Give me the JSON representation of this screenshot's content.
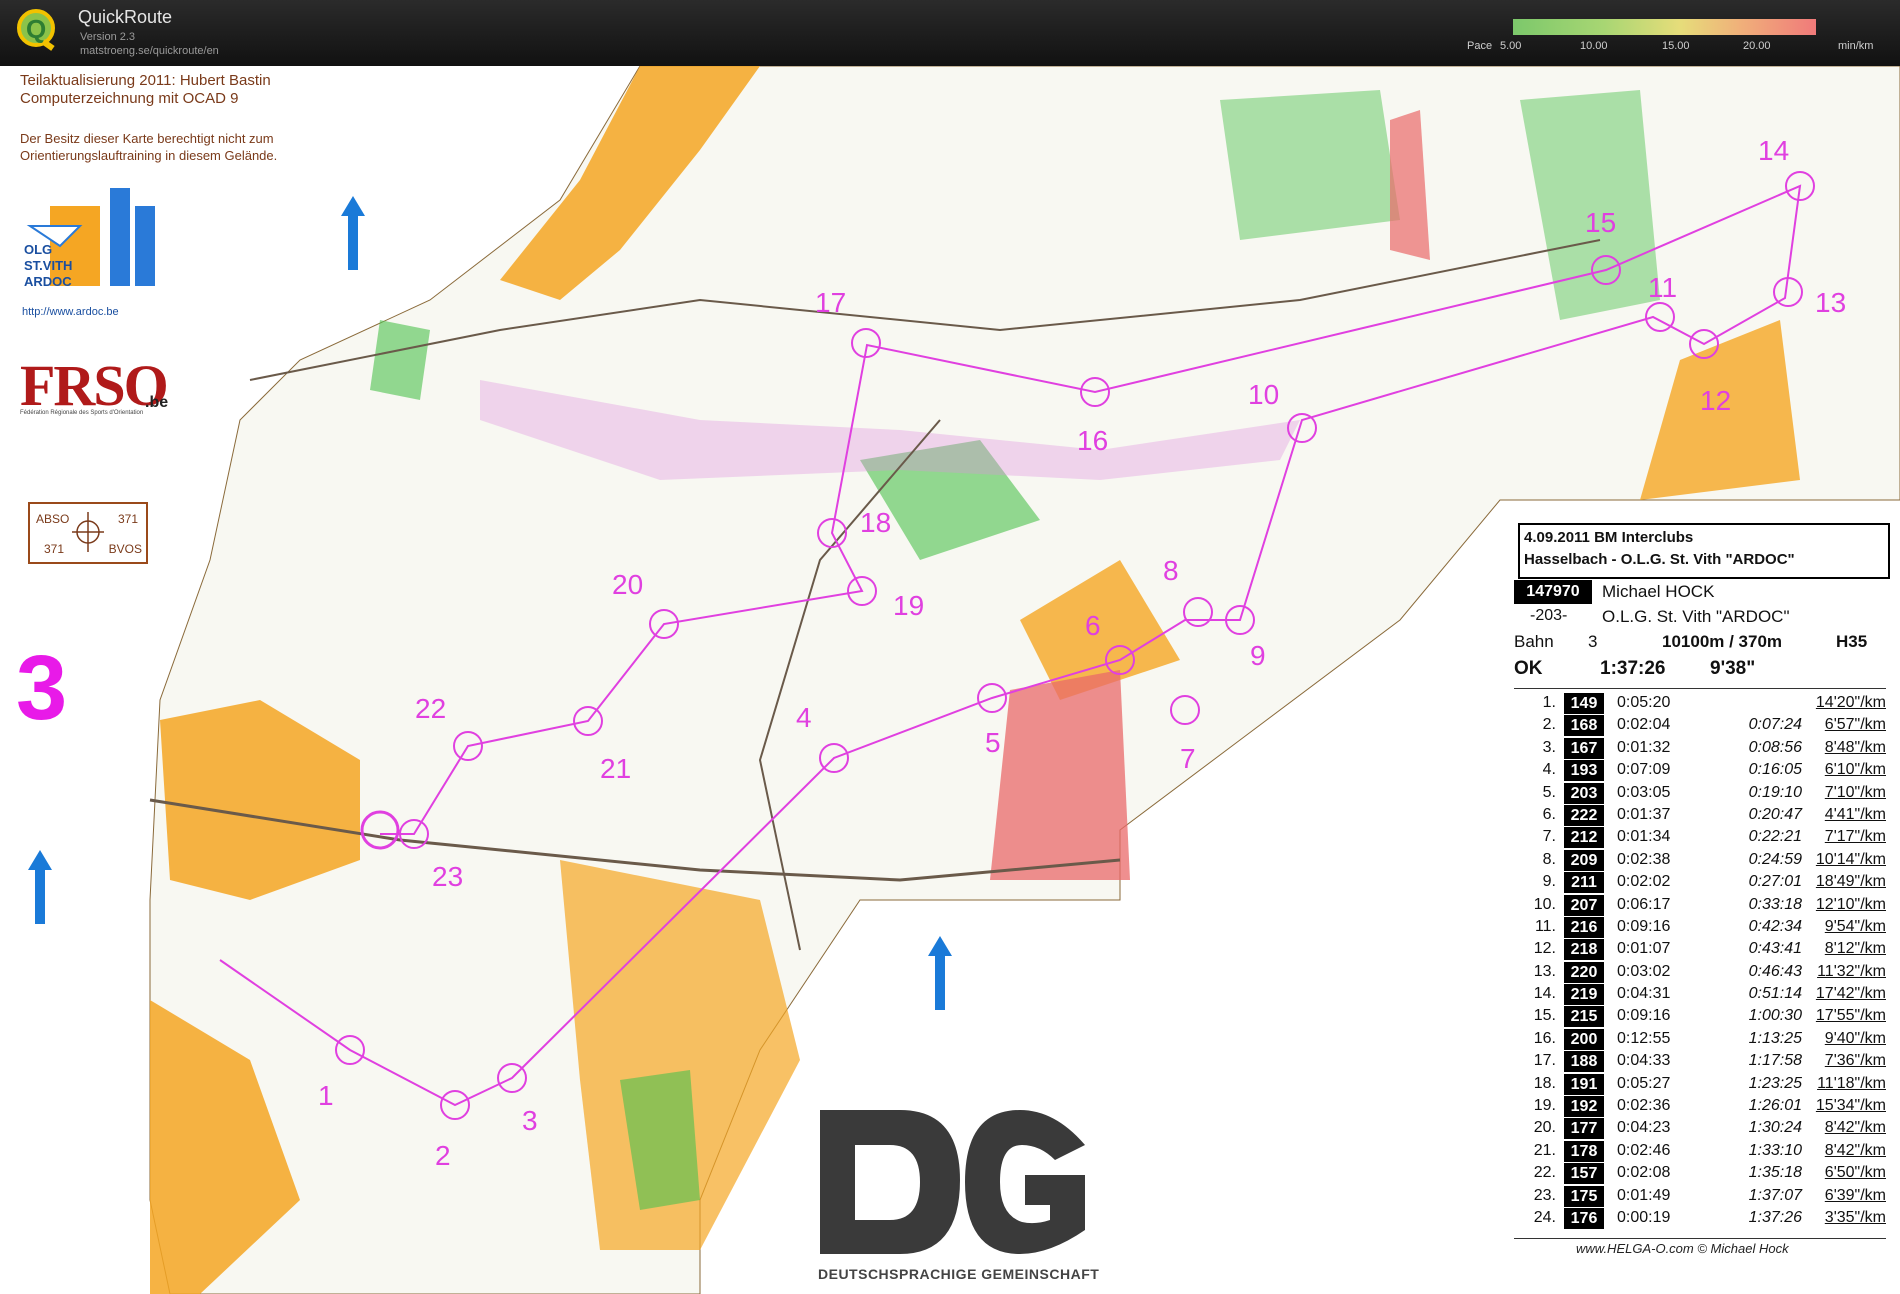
{
  "app": {
    "name": "QuickRoute",
    "version": "Version 2.3",
    "url": "matstroeng.se/quickroute/en"
  },
  "pace_scale": {
    "label": "Pace",
    "ticks": [
      "5.00",
      "10.00",
      "15.00",
      "20.00"
    ],
    "unit": "min/km"
  },
  "map": {
    "credits": [
      "Teilaktualisierung 2011: Hubert Bastin",
      "Computerzeichnung mit OCAD 9"
    ],
    "note": [
      "Der Besitz dieser Karte berechtigt nicht zum",
      "Orientierungslauftraining in diesem Gelände."
    ],
    "club_logo": {
      "lines": [
        "OLG",
        "ST.VITH",
        "ARDOC"
      ],
      "url": "http://www.ardoc.be"
    },
    "federation_logo": {
      "text": "FRSO",
      "suffix": ".be",
      "subtitle": "Fédération Régionale des Sports d'Orientation"
    },
    "compass_box": {
      "tl": "ABSO",
      "tr": "371",
      "bl": "371",
      "br": "BVOS"
    },
    "course_number": "3",
    "control_labels": [
      "1",
      "2",
      "3",
      "4",
      "5",
      "6",
      "7",
      "8",
      "9",
      "10",
      "11",
      "12",
      "13",
      "14",
      "15",
      "16",
      "17",
      "18",
      "19",
      "20",
      "21",
      "22",
      "23"
    ],
    "sponsor": {
      "logo": "DG",
      "text": "DEUTSCHSPRACHIGE GEMEINSCHAFT"
    },
    "colors": {
      "course": "#e040e0",
      "forest": "#ffffff",
      "open_land": "#f5a623",
      "green": "#4cc24c",
      "red_area": "#ea6a6a"
    }
  },
  "results": {
    "event_line1": "4.09.2011  BM Interclubs",
    "event_line2": "Hasselbach - O.L.G. St. Vith \"ARDOC\"",
    "runner_id": "147970",
    "runner_name": "Michael HOCK",
    "club_number": "-203-",
    "club_name": "O.L.G. St. Vith \"ARDOC\"",
    "course_label": "Bahn",
    "course_value": "3",
    "course_length": "10100m / 370m",
    "category": "H35",
    "status": "OK",
    "total_time": "1:37:26",
    "avg_pace": "9'38\"",
    "splits": [
      {
        "n": "1.",
        "code": "149",
        "split": "0:05:20",
        "cum": "",
        "pace": "14'20\"/km"
      },
      {
        "n": "2.",
        "code": "168",
        "split": "0:02:04",
        "cum": "0:07:24",
        "pace": "6'57\"/km"
      },
      {
        "n": "3.",
        "code": "167",
        "split": "0:01:32",
        "cum": "0:08:56",
        "pace": "8'48\"/km"
      },
      {
        "n": "4.",
        "code": "193",
        "split": "0:07:09",
        "cum": "0:16:05",
        "pace": "6'10\"/km"
      },
      {
        "n": "5.",
        "code": "203",
        "split": "0:03:05",
        "cum": "0:19:10",
        "pace": "7'10\"/km"
      },
      {
        "n": "6.",
        "code": "222",
        "split": "0:01:37",
        "cum": "0:20:47",
        "pace": "4'41\"/km"
      },
      {
        "n": "7.",
        "code": "212",
        "split": "0:01:34",
        "cum": "0:22:21",
        "pace": "7'17\"/km"
      },
      {
        "n": "8.",
        "code": "209",
        "split": "0:02:38",
        "cum": "0:24:59",
        "pace": "10'14\"/km"
      },
      {
        "n": "9.",
        "code": "211",
        "split": "0:02:02",
        "cum": "0:27:01",
        "pace": "18'49\"/km"
      },
      {
        "n": "10.",
        "code": "207",
        "split": "0:06:17",
        "cum": "0:33:18",
        "pace": "12'10\"/km"
      },
      {
        "n": "11.",
        "code": "216",
        "split": "0:09:16",
        "cum": "0:42:34",
        "pace": "9'54\"/km"
      },
      {
        "n": "12.",
        "code": "218",
        "split": "0:01:07",
        "cum": "0:43:41",
        "pace": "8'12\"/km"
      },
      {
        "n": "13.",
        "code": "220",
        "split": "0:03:02",
        "cum": "0:46:43",
        "pace": "11'32\"/km"
      },
      {
        "n": "14.",
        "code": "219",
        "split": "0:04:31",
        "cum": "0:51:14",
        "pace": "17'42\"/km"
      },
      {
        "n": "15.",
        "code": "215",
        "split": "0:09:16",
        "cum": "1:00:30",
        "pace": "17'55\"/km"
      },
      {
        "n": "16.",
        "code": "200",
        "split": "0:12:55",
        "cum": "1:13:25",
        "pace": "9'40\"/km"
      },
      {
        "n": "17.",
        "code": "188",
        "split": "0:04:33",
        "cum": "1:17:58",
        "pace": "7'36\"/km"
      },
      {
        "n": "18.",
        "code": "191",
        "split": "0:05:27",
        "cum": "1:23:25",
        "pace": "11'18\"/km"
      },
      {
        "n": "19.",
        "code": "192",
        "split": "0:02:36",
        "cum": "1:26:01",
        "pace": "15'34\"/km"
      },
      {
        "n": "20.",
        "code": "177",
        "split": "0:04:23",
        "cum": "1:30:24",
        "pace": "8'42\"/km"
      },
      {
        "n": "21.",
        "code": "178",
        "split": "0:02:46",
        "cum": "1:33:10",
        "pace": "8'42\"/km"
      },
      {
        "n": "22.",
        "code": "157",
        "split": "0:02:08",
        "cum": "1:35:18",
        "pace": "6'50\"/km"
      },
      {
        "n": "23.",
        "code": "175",
        "split": "0:01:49",
        "cum": "1:37:07",
        "pace": "6'39\"/km"
      },
      {
        "n": "24.",
        "code": "176",
        "split": "0:00:19",
        "cum": "1:37:26",
        "pace": "3'35\"/km"
      }
    ],
    "footer": "www.HELGA-O.com © Michael Hock"
  }
}
